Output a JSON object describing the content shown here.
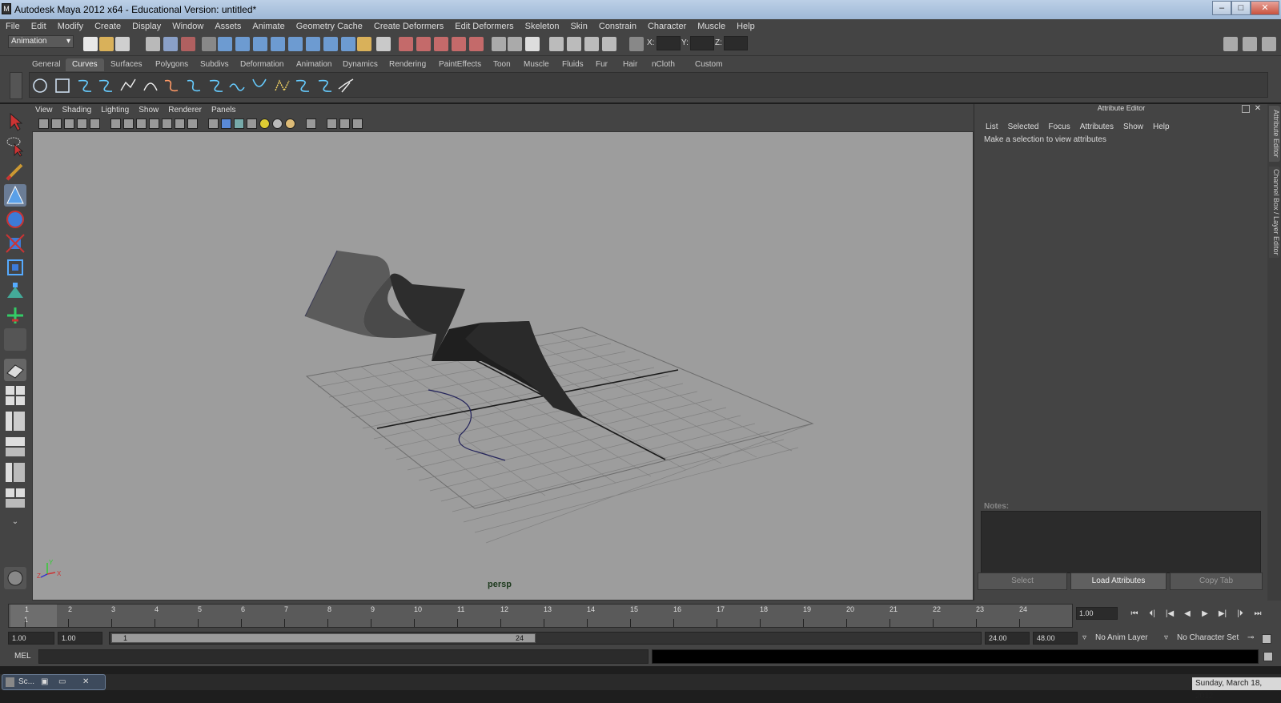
{
  "window": {
    "title": "Autodesk Maya 2012 x64 - Educational Version: untitled*",
    "controls": [
      "–",
      "□",
      "✕"
    ]
  },
  "menubar": [
    "File",
    "Edit",
    "Modify",
    "Create",
    "Display",
    "Window",
    "Assets",
    "Animate",
    "Geometry Cache",
    "Create Deformers",
    "Edit Deformers",
    "Skeleton",
    "Skin",
    "Constrain",
    "Character",
    "Muscle",
    "Help"
  ],
  "statusline": {
    "mode": "Animation",
    "x_label": "X:",
    "y_label": "Y:",
    "z_label": "Z:"
  },
  "shelf": {
    "tabs": [
      "General",
      "Curves",
      "Surfaces",
      "Polygons",
      "Subdivs",
      "Deformation",
      "Animation",
      "Dynamics",
      "Rendering",
      "PaintEffects",
      "Toon",
      "Muscle",
      "Fluids",
      "Fur",
      "Hair",
      "nCloth",
      "Custom"
    ],
    "active_tab": "Curves"
  },
  "viewport": {
    "menu": [
      "View",
      "Shading",
      "Lighting",
      "Show",
      "Renderer",
      "Panels"
    ],
    "camera": "persp",
    "axis_x": "X",
    "axis_y": "Y",
    "axis_z": "Z"
  },
  "attribute_editor": {
    "title": "Attribute Editor",
    "menu": [
      "List",
      "Selected",
      "Focus",
      "Attributes",
      "Show",
      "Help"
    ],
    "hint": "Make a selection to view attributes",
    "notes_label": "Notes:",
    "buttons": {
      "select": "Select",
      "load": "Load Attributes",
      "copy": "Copy Tab"
    }
  },
  "side_tabs": {
    "attr": "Attribute Editor",
    "channel": "Channel Box / Layer Editor"
  },
  "timeslider": {
    "ticks": [
      "1",
      "2",
      "3",
      "4",
      "5",
      "6",
      "7",
      "8",
      "9",
      "10",
      "11",
      "12",
      "13",
      "14",
      "15",
      "16",
      "17",
      "18",
      "19",
      "20",
      "21",
      "22",
      "23",
      "24"
    ],
    "current_frame_marker": "1",
    "current_frame": "1.00",
    "playback": [
      "⏮",
      "⏴|",
      "|◀",
      "◀",
      "▶",
      "▶|",
      "|⏵",
      "⏭"
    ]
  },
  "rangeslider": {
    "start": "1.00",
    "anim_start": "1.00",
    "range_start": "1",
    "range_end": "24",
    "anim_end": "24.00",
    "end": "48.00",
    "anim_layer": "No Anim Layer",
    "character_set": "No Character Set"
  },
  "cmdline": {
    "label": "MEL"
  },
  "taskbar": {
    "item": "Sc...",
    "date": "Sunday, March 18, 2012"
  }
}
